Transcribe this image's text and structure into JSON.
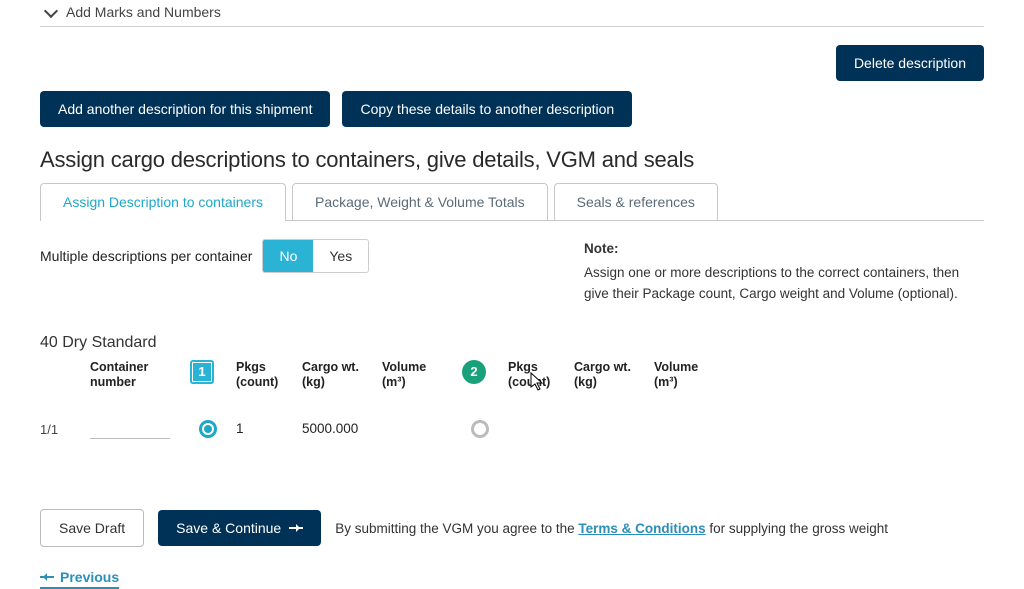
{
  "top": {
    "marks_label": "Add Marks and Numbers"
  },
  "buttons": {
    "delete": "Delete description",
    "add_another": "Add another description for this shipment",
    "copy_details": "Copy these details to another description",
    "save_draft": "Save Draft",
    "save_continue": "Save & Continue",
    "previous": "Previous"
  },
  "section_title": "Assign cargo descriptions to containers, give details, VGM and seals",
  "tabs": {
    "assign": "Assign Description to containers",
    "totals": "Package, Weight & Volume Totals",
    "seals": "Seals & references"
  },
  "multi_desc": {
    "label": "Multiple descriptions per container",
    "no": "No",
    "yes": "Yes"
  },
  "note": {
    "label": "Note:",
    "text": "Assign one or more descriptions to the correct containers, then give their Package count, Cargo weight and Volume (optional)."
  },
  "container_type": "40 Dry Standard",
  "headers": {
    "container_number": "Container number",
    "pkgs": "Pkgs (count)",
    "cargo_wt": "Cargo wt. (kg)",
    "volume": "Volume (m³)"
  },
  "badges": {
    "one": "1",
    "two": "2"
  },
  "row": {
    "index": "1/1",
    "container_number": "",
    "pkgs1": "1",
    "cargo1": "5000.000",
    "vol1": "",
    "pkgs2": "",
    "cargo2": "",
    "vol2": ""
  },
  "submit": {
    "prefix": "By submitting the VGM you agree to the ",
    "terms": "Terms & Conditions",
    "suffix": " for supplying the gross weight"
  }
}
